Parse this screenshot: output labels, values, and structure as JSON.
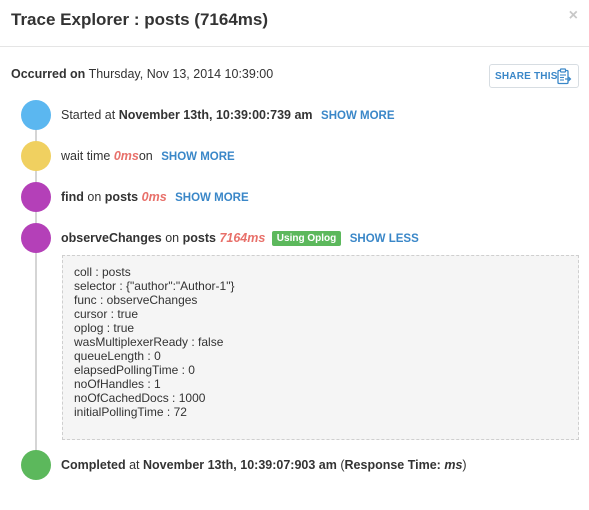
{
  "header": {
    "title": "Trace Explorer : posts (7164ms)",
    "close": "×"
  },
  "occurred": {
    "label": "Occurred on",
    "value": "Thursday, Nov 13, 2014 10:39:00"
  },
  "share": {
    "label": "SHARE THIS"
  },
  "events": {
    "started": {
      "prefix": "Started at",
      "time": "November 13th, 10:39:00:739 am",
      "link": "SHOW MORE"
    },
    "wait": {
      "prefix": "wait time",
      "ms": "0ms",
      "suffix": "on",
      "link": "SHOW MORE"
    },
    "find": {
      "op": "find",
      "on": "on",
      "coll": "posts",
      "ms": "0ms",
      "link": "SHOW MORE"
    },
    "observe": {
      "op": "observeChanges",
      "on": "on",
      "coll": "posts",
      "ms": "7164ms",
      "badge": "Using Oplog",
      "link": "SHOW LESS"
    },
    "completed": {
      "label": "Completed",
      "at": "at",
      "time": "November 13th, 10:39:07:903 am",
      "open": "(",
      "resp_label": "Response Time:",
      "resp_value": "ms",
      "close": ")"
    }
  },
  "details": [
    "coll : posts",
    "selector : {\"author\":\"Author-1\"}",
    "func : observeChanges",
    "cursor : true",
    "oplog : true",
    "wasMultiplexerReady : false",
    "queueLength : 0",
    "elapsedPollingTime : 0",
    "noOfHandles : 1",
    "noOfCachedDocs : 1000",
    "initialPollingTime : 72"
  ],
  "colors": {
    "started_dot": "#5bb7f0",
    "wait_dot": "#f0d060",
    "find_dot": "#b440b8",
    "observe_dot": "#b440b8",
    "completed_dot": "#5cb85c",
    "link": "#3a87c8",
    "ms_red": "#e8706a",
    "badge": "#5cb85c"
  },
  "icons": {
    "close": "close-icon",
    "share": "clipboard-icon"
  }
}
